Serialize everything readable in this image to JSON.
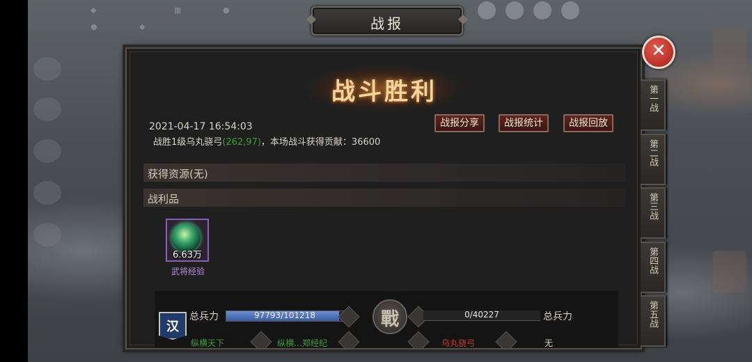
{
  "window": {
    "title": "战报"
  },
  "result": {
    "banner": "战斗胜利"
  },
  "report": {
    "timestamp": "2021-04-17  16:54:03",
    "line_prefix": "战胜1级乌丸骁弓",
    "line_coord": "(262,97)",
    "line_suffix": "，本场战斗获得贡献：36600"
  },
  "actions": {
    "share": "战报分享",
    "stats": "战报统计",
    "replay": "战报回放"
  },
  "sections": {
    "resources": "获得资源(无)",
    "spoils": "战利品"
  },
  "spoils": [
    {
      "name": "武将经验",
      "quantity": "6.63万",
      "icon": "green-gem-icon"
    }
  ],
  "battle": {
    "left_faction": "汉",
    "left_label": "总兵力",
    "left_current": 97793,
    "left_max": 101218,
    "left_text": "97793/101218",
    "vs_glyph": "戰",
    "right_label": "总兵力",
    "right_text": "0/40227",
    "left_row2_a": "纵横天下",
    "left_row2_b": "纵横…郑经纪",
    "right_row2_a": "乌丸骁弓",
    "right_row2_b": "无"
  },
  "tabs": [
    "第一战",
    "第二战",
    "第三战",
    "第四战",
    "第五战"
  ],
  "close": {
    "glyph": "✕"
  },
  "colors": {
    "accent_coord": "#3ba12e",
    "item_purple": "#b98be6",
    "close_red": "#c7302a"
  }
}
